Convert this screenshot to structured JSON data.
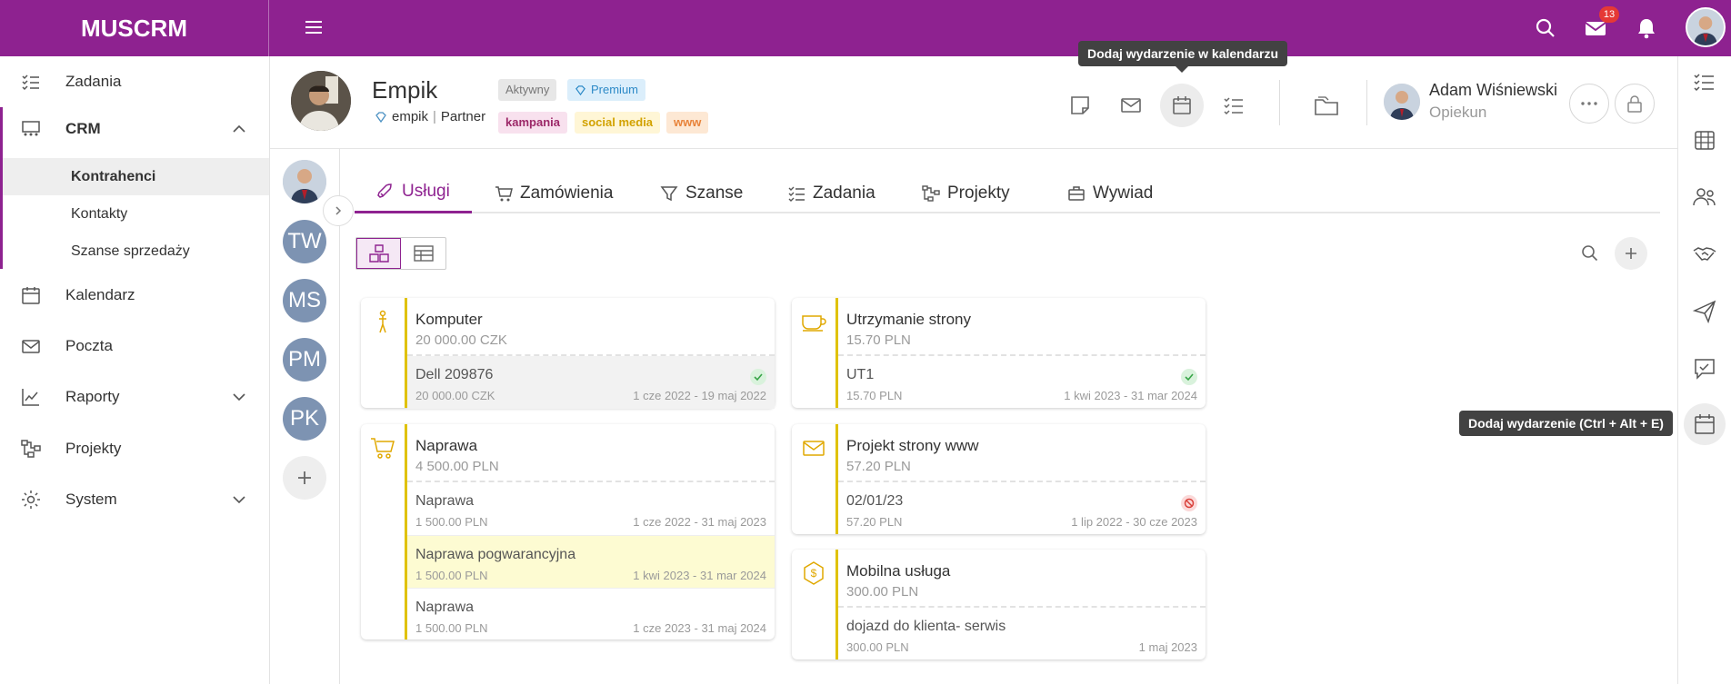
{
  "app": {
    "brand": "MUSCRM",
    "mail_count": "13"
  },
  "sidebar": {
    "zadania": "Zadania",
    "crm": "CRM",
    "crm_sub": [
      "Kontrahenci",
      "Kontakty",
      "Szanse sprzedaży"
    ],
    "kalendarz": "Kalendarz",
    "poczta": "Poczta",
    "raporty": "Raporty",
    "projekty": "Projekty",
    "system": "System"
  },
  "company": {
    "name": "Empik",
    "sub_left": "empik",
    "sub_right": "Partner",
    "status": "Aktywny",
    "tier": "Premium",
    "tags": [
      "kampania",
      "social media",
      "www"
    ]
  },
  "owner": {
    "name": "Adam Wiśniewski",
    "role": "Opiekun"
  },
  "tooltips": {
    "calendar_header": "Dodaj wydarzenie w kalendarzu",
    "add_event": "Dodaj wydarzenie (Ctrl + Alt + E)"
  },
  "people": [
    "TW",
    "MS",
    "PM",
    "PK"
  ],
  "tabs": [
    "Usługi",
    "Zamówienia",
    "Szanse",
    "Zadania",
    "Projekty",
    "Wywiad"
  ],
  "cards": [
    {
      "icon": "person-icon",
      "title": "Komputer",
      "price": "20 000.00 CZK",
      "items": [
        {
          "name": "Dell 209876",
          "price": "20 000.00 CZK",
          "dates": "1 cze 2022 - 19 maj 2022",
          "status": "ok",
          "highlight": "grey"
        }
      ]
    },
    {
      "icon": "cup-icon",
      "title": "Utrzymanie strony",
      "price": "15.70 PLN",
      "items": [
        {
          "name": "UT1",
          "price": "15.70 PLN",
          "dates": "1 kwi 2023 - 31 mar 2024",
          "status": "ok",
          "highlight": "none"
        }
      ]
    },
    {
      "icon": "cart-icon",
      "title": "Naprawa",
      "price": "4 500.00 PLN",
      "items": [
        {
          "name": "Naprawa",
          "price": "1 500.00 PLN",
          "dates": "1 cze 2022 - 31 maj 2023",
          "status": "",
          "highlight": "none"
        },
        {
          "name": "Naprawa pogwarancyjna",
          "price": "1 500.00 PLN",
          "dates": "1 kwi 2023 - 31 mar 2024",
          "status": "",
          "highlight": "yellow"
        },
        {
          "name": "Naprawa",
          "price": "1 500.00 PLN",
          "dates": "1 cze 2023 - 31 maj 2024",
          "status": "",
          "highlight": "none"
        }
      ]
    },
    {
      "icon": "envelope-icon",
      "title": "Projekt strony www",
      "price": "57.20 PLN",
      "items": [
        {
          "name": "02/01/23",
          "price": "57.20 PLN",
          "dates": "1 lip 2022 - 30 cze 2023",
          "status": "blocked",
          "highlight": "none"
        }
      ]
    },
    {
      "icon": "coin-icon",
      "title": "Mobilna usługa",
      "price": "300.00 PLN",
      "items": [
        {
          "name": "dojazd do klienta- serwis",
          "price": "300.00 PLN",
          "dates": "1 maj 2023",
          "status": "",
          "highlight": "none"
        }
      ]
    }
  ],
  "colors": {
    "brand": "#8e2290",
    "accent_bar": "#e0c200",
    "highlight_yellow": "#fdfbd2",
    "highlight_grey": "#f2f2f2"
  }
}
